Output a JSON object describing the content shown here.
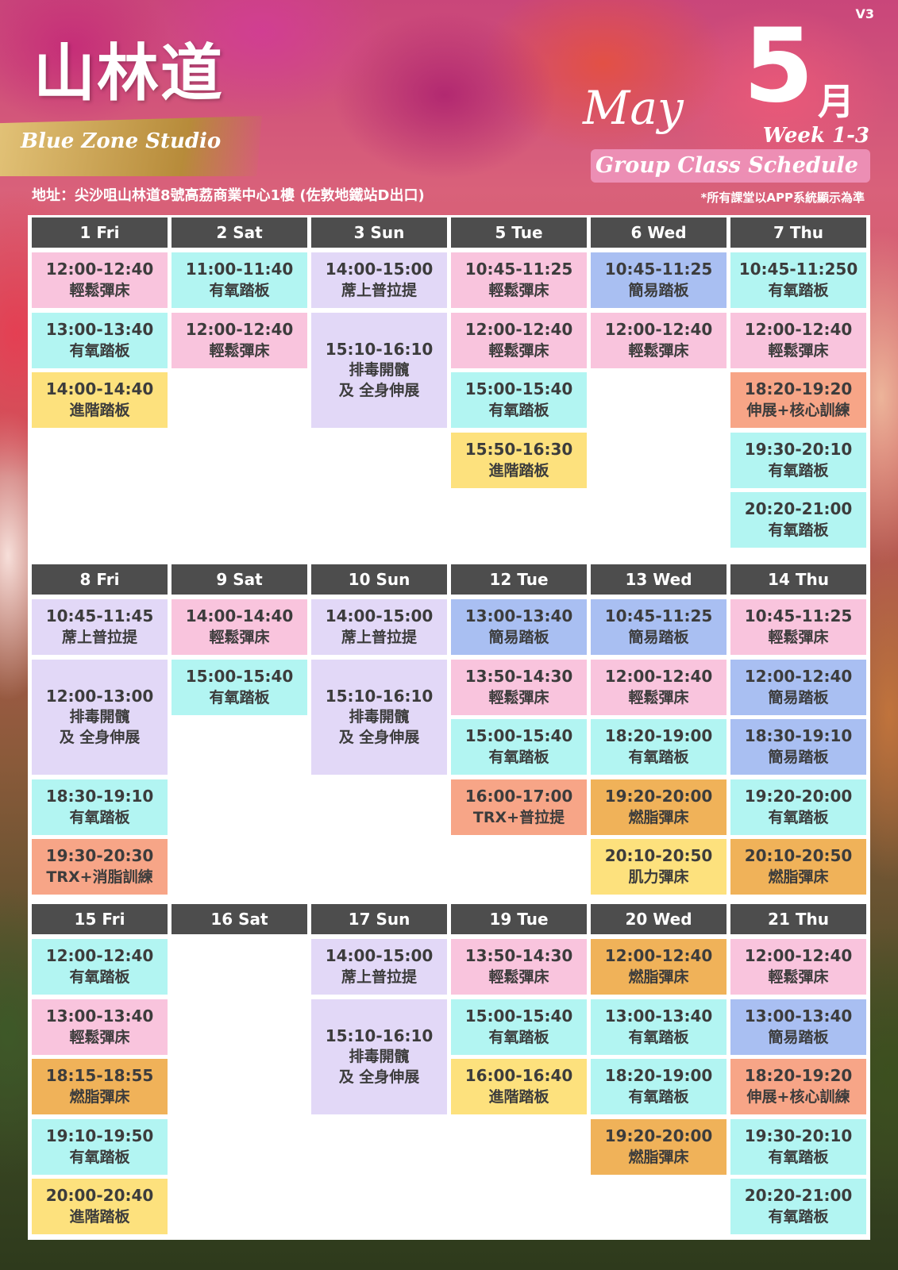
{
  "header": {
    "version": "V3",
    "brand": "山林道",
    "studio": "Blue Zone Studio",
    "address": "地址：尖沙咀山林道8號高荔商業中心1樓 (佐敦地鐵站D出口)",
    "month_number": "5",
    "month_cn": "月",
    "month_en": "May",
    "week": "Week 1-3",
    "title": "Group Class Schedule",
    "note": "*所有課堂以APP系統顯示為準"
  },
  "colors": {
    "pink": "#f9c4dd",
    "cyan": "#b2f5f2",
    "lavender": "#e2d8f7",
    "blue": "#a9bff2",
    "yellow": "#fde17d",
    "salmon": "#f7a587",
    "orange": "#f0b259",
    "header": "#4d4d4d"
  },
  "weeks": [
    {
      "days": [
        {
          "label": "1 Fri",
          "classes": [
            {
              "time": "12:00-12:40",
              "name": "輕鬆彈床",
              "color": "pink"
            },
            {
              "time": "13:00-13:40",
              "name": "有氧踏板",
              "color": "cyan"
            },
            {
              "time": "14:00-14:40",
              "name": "進階踏板",
              "color": "yellow"
            }
          ]
        },
        {
          "label": "2 Sat",
          "classes": [
            {
              "time": "11:00-11:40",
              "name": "有氧踏板",
              "color": "cyan"
            },
            {
              "time": "12:00-12:40",
              "name": "輕鬆彈床",
              "color": "pink"
            }
          ]
        },
        {
          "label": "3 Sun",
          "classes": [
            {
              "time": "14:00-15:00",
              "name": "蓆上普拉提",
              "color": "lavender"
            },
            {
              "time": "15:10-16:10",
              "name": "排毒開髖",
              "name2": "及 全身伸展",
              "color": "lavender",
              "span": 2
            }
          ]
        },
        {
          "label": "5 Tue",
          "classes": [
            {
              "time": "10:45-11:25",
              "name": "輕鬆彈床",
              "color": "pink"
            },
            {
              "time": "12:00-12:40",
              "name": "輕鬆彈床",
              "color": "pink"
            },
            {
              "time": "15:00-15:40",
              "name": "有氧踏板",
              "color": "cyan"
            },
            {
              "time": "15:50-16:30",
              "name": "進階踏板",
              "color": "yellow"
            }
          ]
        },
        {
          "label": "6 Wed",
          "classes": [
            {
              "time": "10:45-11:25",
              "name": "簡易踏板",
              "color": "blue"
            },
            {
              "time": "12:00-12:40",
              "name": "輕鬆彈床",
              "color": "pink"
            }
          ]
        },
        {
          "label": "7 Thu",
          "classes": [
            {
              "time": "10:45-11:250",
              "name": "有氧踏板",
              "color": "cyan"
            },
            {
              "time": "12:00-12:40",
              "name": "輕鬆彈床",
              "color": "pink"
            },
            {
              "time": "18:20-19:20",
              "name": "伸展+核心訓練",
              "color": "salmon"
            },
            {
              "time": "19:30-20:10",
              "name": "有氧踏板",
              "color": "cyan"
            },
            {
              "time": "20:20-21:00",
              "name": "有氧踏板",
              "color": "cyan"
            }
          ]
        }
      ]
    },
    {
      "days": [
        {
          "label": "8 Fri",
          "classes": [
            {
              "time": "10:45-11:45",
              "name": "蓆上普拉提",
              "color": "lavender"
            },
            {
              "time": "12:00-13:00",
              "name": "排毒開髖",
              "name2": "及 全身伸展",
              "color": "lavender",
              "span": 2
            },
            {
              "time": "18:30-19:10",
              "name": "有氧踏板",
              "color": "cyan"
            },
            {
              "time": "19:30-20:30",
              "name": "TRX+消脂訓練",
              "color": "salmon"
            }
          ]
        },
        {
          "label": "9 Sat",
          "classes": [
            {
              "time": "14:00-14:40",
              "name": "輕鬆彈床",
              "color": "pink"
            },
            {
              "time": "15:00-15:40",
              "name": "有氧踏板",
              "color": "cyan"
            }
          ]
        },
        {
          "label": "10 Sun",
          "classes": [
            {
              "time": "14:00-15:00",
              "name": "蓆上普拉提",
              "color": "lavender"
            },
            {
              "time": "15:10-16:10",
              "name": "排毒開髖",
              "name2": "及 全身伸展",
              "color": "lavender",
              "span": 2
            }
          ]
        },
        {
          "label": "12 Tue",
          "classes": [
            {
              "time": "13:00-13:40",
              "name": "簡易踏板",
              "color": "blue"
            },
            {
              "time": "13:50-14:30",
              "name": "輕鬆彈床",
              "color": "pink"
            },
            {
              "time": "15:00-15:40",
              "name": "有氧踏板",
              "color": "cyan"
            },
            {
              "time": "16:00-17:00",
              "name": "TRX+普拉提",
              "color": "salmon"
            }
          ]
        },
        {
          "label": "13 Wed",
          "classes": [
            {
              "time": "10:45-11:25",
              "name": "簡易踏板",
              "color": "blue"
            },
            {
              "time": "12:00-12:40",
              "name": "輕鬆彈床",
              "color": "pink"
            },
            {
              "time": "18:20-19:00",
              "name": "有氧踏板",
              "color": "cyan"
            },
            {
              "time": "19:20-20:00",
              "name": "燃脂彈床",
              "color": "orange"
            },
            {
              "time": "20:10-20:50",
              "name": "肌力彈床",
              "color": "yellow"
            }
          ]
        },
        {
          "label": "14 Thu",
          "classes": [
            {
              "time": "10:45-11:25",
              "name": "輕鬆彈床",
              "color": "pink"
            },
            {
              "time": "12:00-12:40",
              "name": "簡易踏板",
              "color": "blue"
            },
            {
              "time": "18:30-19:10",
              "name": "簡易踏板",
              "color": "blue"
            },
            {
              "time": "19:20-20:00",
              "name": "有氧踏板",
              "color": "cyan"
            },
            {
              "time": "20:10-20:50",
              "name": "燃脂彈床",
              "color": "orange"
            }
          ]
        }
      ]
    },
    {
      "days": [
        {
          "label": "15 Fri",
          "classes": [
            {
              "time": "12:00-12:40",
              "name": "有氧踏板",
              "color": "cyan"
            },
            {
              "time": "13:00-13:40",
              "name": "輕鬆彈床",
              "color": "pink"
            },
            {
              "time": "18:15-18:55",
              "name": "燃脂彈床",
              "color": "orange"
            },
            {
              "time": "19:10-19:50",
              "name": "有氧踏板",
              "color": "cyan"
            },
            {
              "time": "20:00-20:40",
              "name": "進階踏板",
              "color": "yellow"
            }
          ]
        },
        {
          "label": "16 Sat",
          "classes": []
        },
        {
          "label": "17 Sun",
          "classes": [
            {
              "time": "14:00-15:00",
              "name": "蓆上普拉提",
              "color": "lavender"
            },
            {
              "time": "15:10-16:10",
              "name": "排毒開髖",
              "name2": "及 全身伸展",
              "color": "lavender",
              "span": 2
            }
          ]
        },
        {
          "label": "19 Tue",
          "classes": [
            {
              "time": "13:50-14:30",
              "name": "輕鬆彈床",
              "color": "pink"
            },
            {
              "time": "15:00-15:40",
              "name": "有氧踏板",
              "color": "cyan"
            },
            {
              "time": "16:00-16:40",
              "name": "進階踏板",
              "color": "yellow"
            }
          ]
        },
        {
          "label": "20 Wed",
          "classes": [
            {
              "time": "12:00-12:40",
              "name": "燃脂彈床",
              "color": "orange"
            },
            {
              "time": "13:00-13:40",
              "name": "有氧踏板",
              "color": "cyan"
            },
            {
              "time": "18:20-19:00",
              "name": "有氧踏板",
              "color": "cyan"
            },
            {
              "time": "19:20-20:00",
              "name": "燃脂彈床",
              "color": "orange"
            }
          ]
        },
        {
          "label": "21 Thu",
          "classes": [
            {
              "time": "12:00-12:40",
              "name": "輕鬆彈床",
              "color": "pink"
            },
            {
              "time": "13:00-13:40",
              "name": "簡易踏板",
              "color": "blue"
            },
            {
              "time": "18:20-19:20",
              "name": "伸展+核心訓練",
              "color": "salmon"
            },
            {
              "time": "19:30-20:10",
              "name": "有氧踏板",
              "color": "cyan"
            },
            {
              "time": "20:20-21:00",
              "name": "有氧踏板",
              "color": "cyan"
            }
          ]
        }
      ]
    }
  ]
}
